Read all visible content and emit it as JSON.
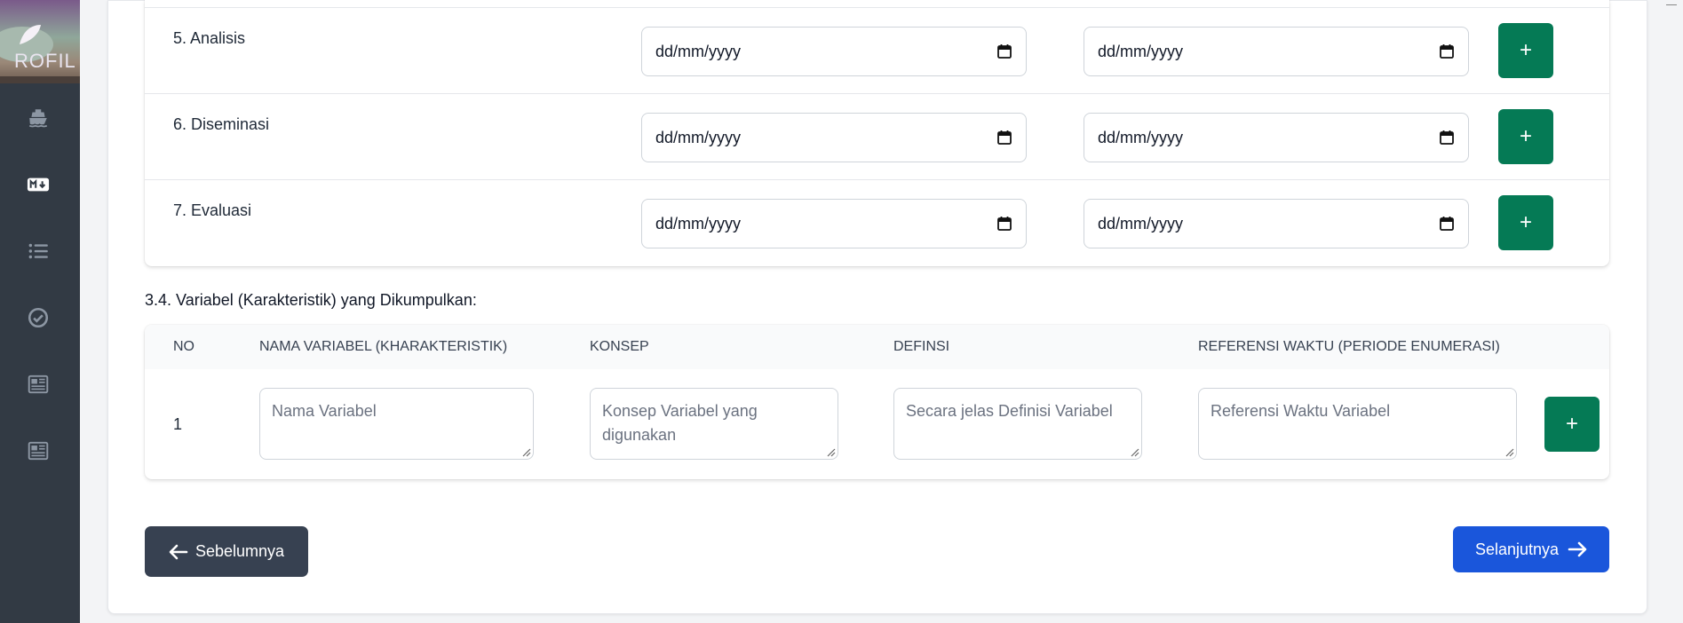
{
  "sidebar": {
    "logo_text": "ROFIL",
    "items": [
      {
        "icon": "ship-icon"
      },
      {
        "icon": "markdown-icon"
      },
      {
        "icon": "list-icon"
      },
      {
        "icon": "check-circle-icon"
      },
      {
        "icon": "newspaper-icon"
      },
      {
        "icon": "newspaper-icon"
      }
    ]
  },
  "stages": [
    {
      "label": "5. Analisis",
      "start_placeholder": "dd/mm/yyyy",
      "end_placeholder": "dd/mm/yyyy",
      "add_label": "+"
    },
    {
      "label": "6. Diseminasi",
      "start_placeholder": "dd/mm/yyyy",
      "end_placeholder": "dd/mm/yyyy",
      "add_label": "+"
    },
    {
      "label": "7. Evaluasi",
      "start_placeholder": "dd/mm/yyyy",
      "end_placeholder": "dd/mm/yyyy",
      "add_label": "+"
    }
  ],
  "variables": {
    "section_title": "3.4. Variabel (Karakteristik) yang Dikumpulkan:",
    "headers": {
      "no": "NO",
      "name": "NAMA VARIABEL (KHARAKTERISTIK)",
      "concept": "KONSEP",
      "definition": "DEFINSI",
      "time_ref": "REFERENSI WAKTU (PERIODE ENUMERASI)"
    },
    "rows": [
      {
        "no": "1",
        "name_placeholder": "Nama Variabel",
        "concept_placeholder": "Konsep Variabel yang digunakan",
        "definition_placeholder": "Secara jelas Definisi Variabel",
        "time_ref_placeholder": "Referensi Waktu Variabel",
        "add_label": "+"
      }
    ]
  },
  "nav": {
    "prev_label": "Sebelumnya",
    "next_label": "Selanjutnya"
  },
  "colors": {
    "sidebar_bg": "#323a44",
    "add_button": "#057a55",
    "prev_button": "#374151",
    "next_button": "#1a56db"
  }
}
